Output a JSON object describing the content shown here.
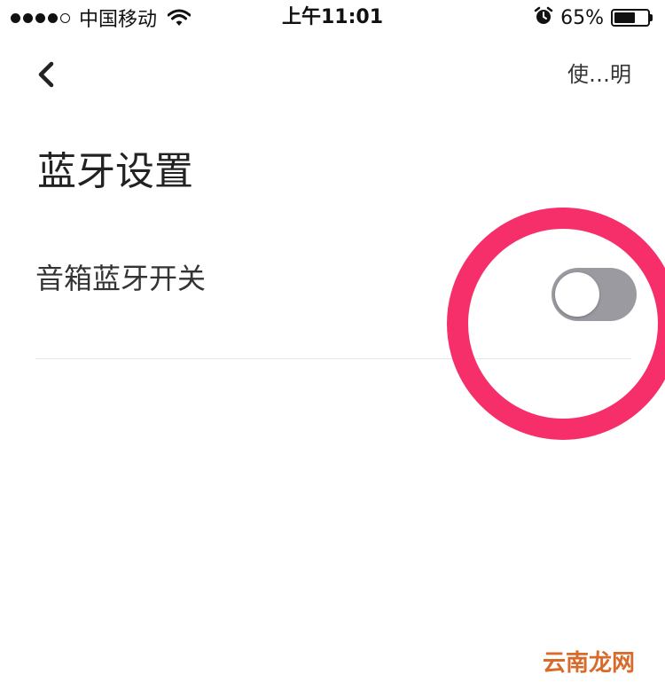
{
  "status_bar": {
    "signal_filled": 4,
    "signal_total": 5,
    "carrier": "中国移动",
    "time": "上午11:01",
    "battery_percent_label": "65%",
    "battery_level": 0.65,
    "icons": [
      "wifi-icon",
      "alarm-icon",
      "battery-icon"
    ]
  },
  "nav": {
    "back_icon": "chevron-left-icon",
    "help_label": "使…明"
  },
  "page": {
    "title": "蓝牙设置"
  },
  "settings": [
    {
      "label": "音箱蓝牙开关",
      "enabled": false
    }
  ],
  "colors": {
    "toggle_off": "#9a9aa0",
    "highlight": "#f62f6a",
    "watermark": "#d86a2a"
  },
  "watermark": "云南龙网"
}
